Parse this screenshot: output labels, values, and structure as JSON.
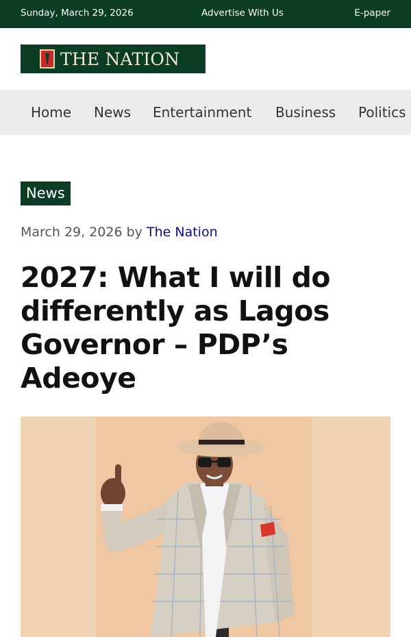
{
  "topbar": {
    "date": "Sunday, March 29, 2026",
    "advertise": "Advertise With Us",
    "epaper": "E-paper"
  },
  "logo": {
    "text": "THE NATION"
  },
  "nav": {
    "items": [
      "Home",
      "News",
      "Entertainment",
      "Business",
      "Politics"
    ]
  },
  "article": {
    "category": "News",
    "date": "March 29, 2026",
    "by": "by",
    "author": "The Nation",
    "title": "2027: What I will do differently as Lagos Governor – PDP’s Adeoye"
  },
  "colors": {
    "brand_green": "#0b3d24",
    "nav_bg": "#ececec",
    "author_link": "#0b0b8c",
    "pocket_square": "#d9352b"
  },
  "icons": {
    "logo_emblem": "nation-emblem-icon"
  }
}
